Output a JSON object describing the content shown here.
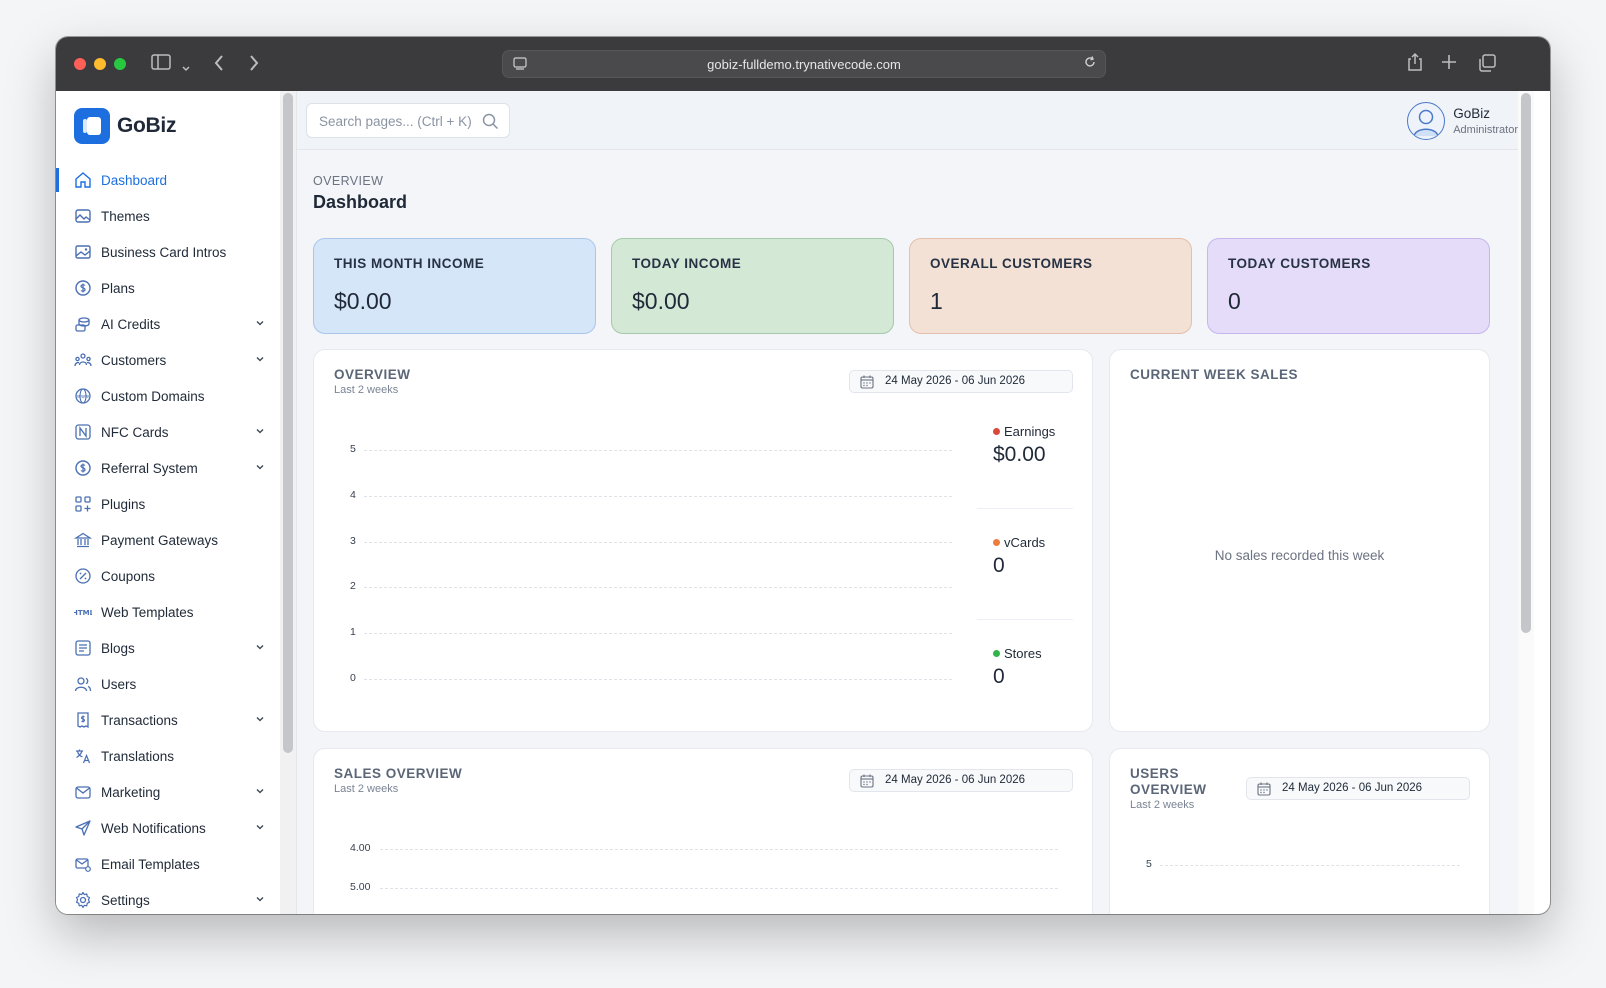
{
  "browser": {
    "url": "gobiz-fulldemo.trynativecode.com"
  },
  "brand": {
    "name": "GoBiz",
    "color": "#1d6fe0"
  },
  "sidebar": {
    "items": [
      {
        "label": "Dashboard",
        "icon": "home-icon",
        "active": true,
        "expandable": false
      },
      {
        "label": "Themes",
        "icon": "image-icon",
        "expandable": false
      },
      {
        "label": "Business Card Intros",
        "icon": "photo-icon",
        "expandable": false
      },
      {
        "label": "Plans",
        "icon": "dollar-circle-icon",
        "expandable": false
      },
      {
        "label": "AI Credits",
        "icon": "coins-icon",
        "expandable": true
      },
      {
        "label": "Customers",
        "icon": "users-group-icon",
        "expandable": true
      },
      {
        "label": "Custom Domains",
        "icon": "globe-www-icon",
        "expandable": false
      },
      {
        "label": "NFC Cards",
        "icon": "nfc-icon",
        "expandable": true
      },
      {
        "label": "Referral System",
        "icon": "dollar-circle-icon",
        "expandable": true
      },
      {
        "label": "Plugins",
        "icon": "apps-add-icon",
        "expandable": false
      },
      {
        "label": "Payment Gateways",
        "icon": "bank-icon",
        "expandable": false
      },
      {
        "label": "Coupons",
        "icon": "discount-icon",
        "expandable": false
      },
      {
        "label": "Web Templates",
        "icon": "html-icon",
        "expandable": false
      },
      {
        "label": "Blogs",
        "icon": "article-icon",
        "expandable": true
      },
      {
        "label": "Users",
        "icon": "users-icon",
        "expandable": false
      },
      {
        "label": "Transactions",
        "icon": "receipt-icon",
        "expandable": true
      },
      {
        "label": "Translations",
        "icon": "language-icon",
        "expandable": false
      },
      {
        "label": "Marketing",
        "icon": "mail-icon",
        "expandable": true
      },
      {
        "label": "Web Notifications",
        "icon": "send-icon",
        "expandable": true
      },
      {
        "label": "Email Templates",
        "icon": "mail-settings-icon",
        "expandable": false
      },
      {
        "label": "Settings",
        "icon": "gear-icon",
        "expandable": true
      }
    ]
  },
  "topbar": {
    "search_placeholder": "Search pages... (Ctrl + K)",
    "user_name": "GoBiz",
    "user_role": "Administrator"
  },
  "page": {
    "crumb": "OVERVIEW",
    "title": "Dashboard"
  },
  "stats": [
    {
      "label": "THIS MONTH INCOME",
      "value": "$0.00",
      "bg": "#d6e6f9",
      "border": "#a9c6ea"
    },
    {
      "label": "TODAY INCOME",
      "value": "$0.00",
      "bg": "#d4e8d6",
      "border": "#a7c9ab"
    },
    {
      "label": "OVERALL CUSTOMERS",
      "value": "1",
      "bg": "#f3e1d6",
      "border": "#e2c0ab"
    },
    {
      "label": "TODAY CUSTOMERS",
      "value": "0",
      "bg": "#e4dcf8",
      "border": "#c5b7ee"
    }
  ],
  "overview": {
    "title": "OVERVIEW",
    "subtitle": "Last 2 weeks",
    "date_range": "24 May 2026 - 06 Jun 2026",
    "legend": [
      {
        "label": "Earnings",
        "value": "$0.00",
        "color": "#d9483b"
      },
      {
        "label": "vCards",
        "value": "0",
        "color": "#f07b3f"
      },
      {
        "label": "Stores",
        "value": "0",
        "color": "#2fb54a"
      }
    ]
  },
  "week_sales": {
    "title": "CURRENT WEEK SALES",
    "empty_text": "No sales recorded this week"
  },
  "sales_overview": {
    "title": "SALES OVERVIEW",
    "subtitle": "Last 2 weeks",
    "date_range": "24 May 2026 - 06 Jun 2026"
  },
  "users_overview": {
    "title_line1": "USERS",
    "title_line2": "OVERVIEW",
    "subtitle": "Last 2 weeks",
    "date_range": "24 May 2026 - 06 Jun 2026"
  },
  "chart_data": [
    {
      "type": "line",
      "series": [
        {
          "name": "Earnings",
          "values": []
        },
        {
          "name": "vCards",
          "values": []
        },
        {
          "name": "Stores",
          "values": []
        }
      ],
      "ylim": [
        0,
        5
      ],
      "yticks": [
        "0",
        "1",
        "2",
        "3",
        "4",
        "5"
      ],
      "grid": true
    },
    {
      "type": "line",
      "series": [],
      "yticks": [
        "4.00",
        "5.00"
      ],
      "grid": true
    },
    {
      "type": "line",
      "series": [],
      "yticks": [
        "5"
      ],
      "grid": true
    }
  ]
}
